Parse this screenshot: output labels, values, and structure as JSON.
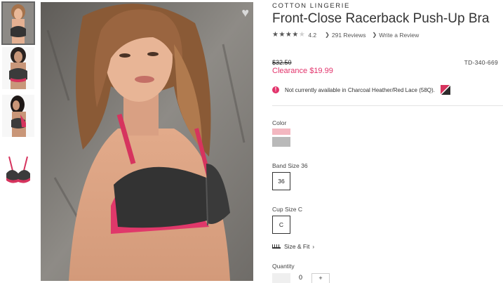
{
  "colors": {
    "accent": "#e2336b",
    "swatch_pink": "#f3b7c0",
    "swatch_gray": "#b9b9b9"
  },
  "product": {
    "brand": "COTTON LINGERIE",
    "title": "Front-Close Racerback Push-Up Bra",
    "rating": {
      "stars": 4.2,
      "value": "4.2",
      "reviews_link": "291 Reviews",
      "write_link": "Write a Review"
    },
    "old_price": "$32.50",
    "sale_price": "Clearance $19.99",
    "sku": "TD-340-669",
    "availability": "Not currently available in Charcoal Heather/Red Lace (58Q).",
    "color_label": "Color",
    "band": {
      "label": "Band Size 36",
      "selected": "36"
    },
    "cup": {
      "label": "Cup Size C",
      "selected": "C"
    },
    "size_fit": "Size & Fit",
    "quantity": {
      "label": "Quantity",
      "value": "0",
      "plus": "+"
    }
  },
  "icons": {
    "favorite": "heart-icon",
    "alert": "exclamation-circle-icon",
    "ruler": "ruler-icon",
    "link_arrow": "chevron-right-icon"
  }
}
